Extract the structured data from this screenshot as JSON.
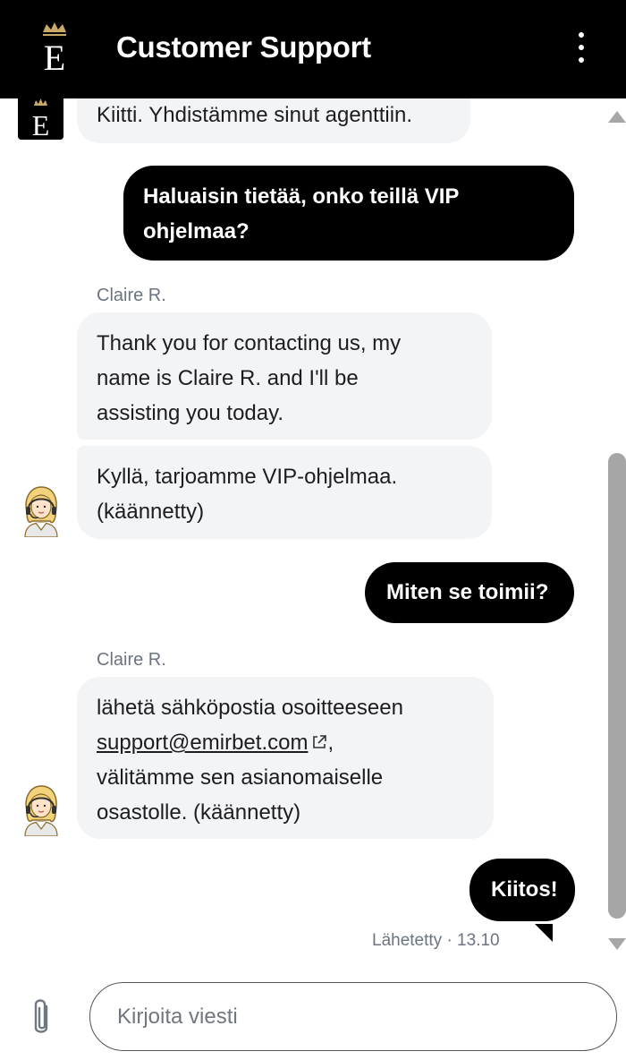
{
  "header": {
    "title": "Customer Support",
    "logo_letter": "E"
  },
  "messages": {
    "bot_first": "Kiitti. Yhdistämme sinut agenttiin.",
    "user_1_line1": "Haluaisin tietää, onko teillä VIP",
    "user_1_line2": "ohjelmaa?",
    "agent_name_1": "Claire R.",
    "agent_1a_line1": "Thank you for contacting us, my",
    "agent_1a_line2": "name is Claire R. and I'll be",
    "agent_1a_line3": "assisting you today.",
    "agent_1b_line1": "Kyllä, tarjoamme VIP-ohjelmaa.",
    "agent_1b_line2": "(käännetty)",
    "user_2": "Miten se toimii?",
    "agent_name_2": "Claire R.",
    "agent_2_line1": "lähetä sähköpostia osoitteeseen",
    "agent_2_email": "support@emirbet.com",
    "agent_2_after_email": ",",
    "agent_2_line3": "välitämme sen asianomaiselle",
    "agent_2_line4": "osastolle. (käännetty)",
    "user_3": "Kiitos!",
    "user_3_status": "Lähetetty · 13.10"
  },
  "composer": {
    "placeholder": "Kirjoita viesti",
    "value": ""
  },
  "colors": {
    "header_bg": "#000000",
    "agent_bubble": "#f3f4f6",
    "user_bubble": "#000000",
    "logo_crown": "#c9a86a",
    "scrollbar": "#a6a6a6"
  }
}
